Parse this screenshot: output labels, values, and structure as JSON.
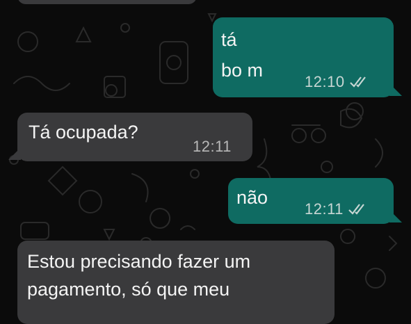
{
  "messages": [
    {
      "direction": "incoming",
      "text": ""
    },
    {
      "direction": "outgoing",
      "lines": [
        "tá",
        "bo m"
      ],
      "time": "12:10",
      "status": "read-double-check-icon"
    },
    {
      "direction": "incoming",
      "text": "Tá ocupada?",
      "time": "12:11"
    },
    {
      "direction": "outgoing",
      "text": "não",
      "time": "12:11",
      "status": "read-double-check-icon"
    },
    {
      "direction": "incoming",
      "lines": [
        "Estou precisando fazer um",
        "pagamento, só que meu"
      ]
    }
  ],
  "colors": {
    "background": "#0b0b0b",
    "incoming_bubble": "#3a3a3c",
    "outgoing_bubble": "#0f6b62",
    "text": "#f4f4f4",
    "time": "#c7d6d3"
  }
}
